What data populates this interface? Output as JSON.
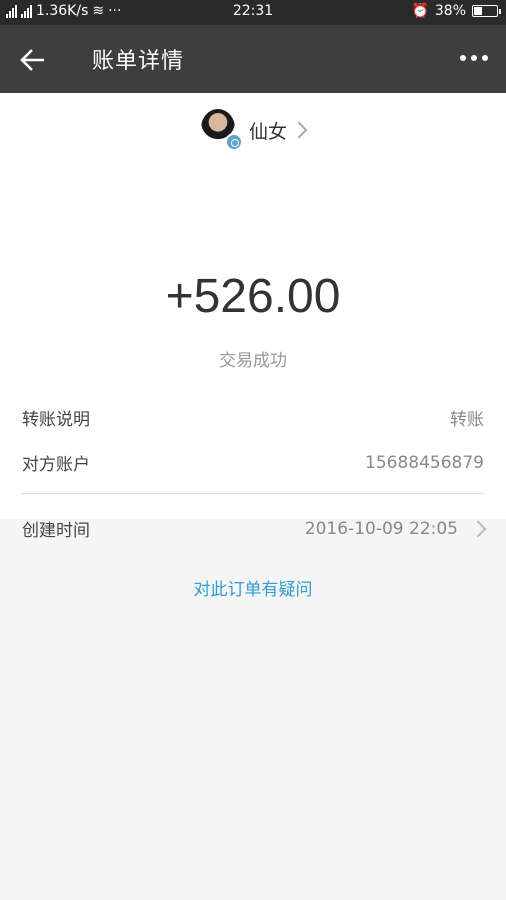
{
  "status_bar": {
    "network": "1.36K/s",
    "time": "22:31",
    "battery_percent": "38%",
    "battery_level": 0.38
  },
  "header": {
    "title": "账单详情",
    "back_icon": "back-arrow-icon",
    "more_icon": "more-icon"
  },
  "payee": {
    "name": "仙女"
  },
  "transaction": {
    "amount": "+526.00",
    "status": "交易成功"
  },
  "details": {
    "note_label": "转账说明",
    "note_value": "转账",
    "account_label": "对方账户",
    "account_value": "15688456879",
    "created_label": "创建时间",
    "created_value": "2016-10-09 22:05"
  },
  "links": {
    "question": "对此订单有疑问"
  },
  "colors": {
    "nav_background": "#3e3e3e",
    "link": "#2d9ed8"
  }
}
